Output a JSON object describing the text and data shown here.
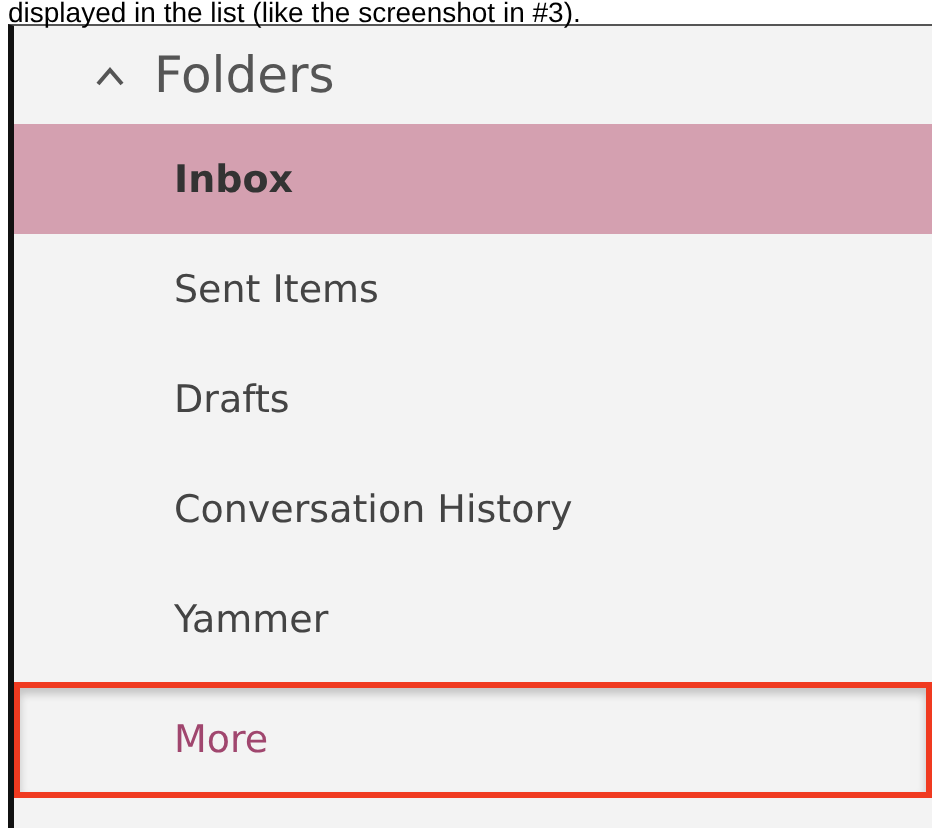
{
  "caption": "displayed in the list (like the screenshot in #3).",
  "section": {
    "title": "Folders",
    "expanded": true
  },
  "folders": [
    {
      "label": "Inbox",
      "kind": "folder",
      "selected": true,
      "highlighted": false
    },
    {
      "label": "Sent Items",
      "kind": "folder",
      "selected": false,
      "highlighted": false
    },
    {
      "label": "Drafts",
      "kind": "folder",
      "selected": false,
      "highlighted": false
    },
    {
      "label": "Conversation History",
      "kind": "folder",
      "selected": false,
      "highlighted": false
    },
    {
      "label": "Yammer",
      "kind": "folder",
      "selected": false,
      "highlighted": false
    },
    {
      "label": "More",
      "kind": "more",
      "selected": false,
      "highlighted": true
    }
  ]
}
